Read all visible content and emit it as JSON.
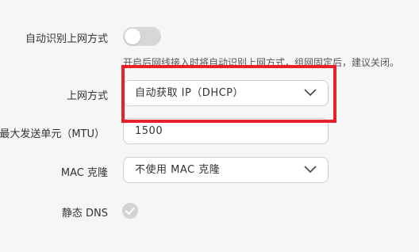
{
  "auto_detect": {
    "label": "自动识别上网方式",
    "enabled": false,
    "hint": "开启后网线接入时将自动识别上网方式，组网固定后，建议关闭。"
  },
  "connection_type": {
    "label": "上网方式",
    "value": "自动获取 IP（DHCP）",
    "icon": "chevron-down-icon"
  },
  "mtu": {
    "label": "最大发送单元（MTU）",
    "value": "1500"
  },
  "mac_clone": {
    "label": "MAC 克隆",
    "value": "不使用 MAC 克隆",
    "icon": "chevron-down-icon"
  },
  "static_dns": {
    "label": "静态 DNS",
    "checked": true,
    "icon": "check-icon"
  },
  "colors": {
    "highlight": "#e8202a",
    "toggle_off": "#d7d7d7",
    "check_fill": "#d3d3d3"
  }
}
